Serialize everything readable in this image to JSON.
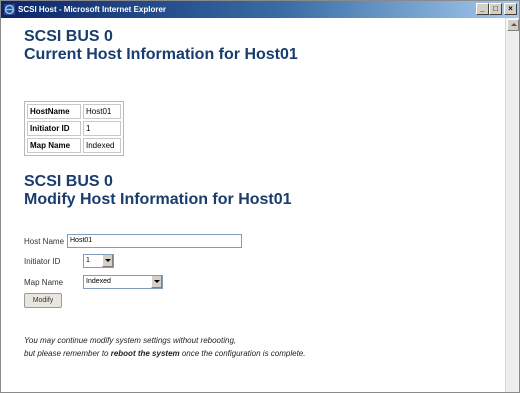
{
  "window": {
    "title": "SCSI Host - Microsoft Internet Explorer",
    "minimize": "_",
    "maximize": "□",
    "close": "×"
  },
  "current": {
    "heading_line1": "SCSI BUS 0",
    "heading_line2": "Current Host Information for Host01",
    "rows": [
      {
        "label": "HostName",
        "value": "Host01"
      },
      {
        "label": "Initiator ID",
        "value": "1"
      },
      {
        "label": "Map Name",
        "value": "Indexed"
      }
    ]
  },
  "modify": {
    "heading_line1": "SCSI BUS 0",
    "heading_line2": "Modify Host Information for Host01",
    "host_name_label": "Host Name",
    "host_name_value": "Host01",
    "initiator_label": "Initiator ID",
    "initiator_value": "1",
    "map_label": "Map Name",
    "map_value": "Indexed",
    "button_label": "Modify"
  },
  "note": {
    "line1": "You may continue modify system settings without rebooting,",
    "line2_prefix": "but please remember to ",
    "line2_bold": "reboot the system",
    "line2_suffix": " once the configuration is complete."
  },
  "colors": {
    "heading": "#1a3d6e",
    "titlebar": "#0a246a"
  }
}
